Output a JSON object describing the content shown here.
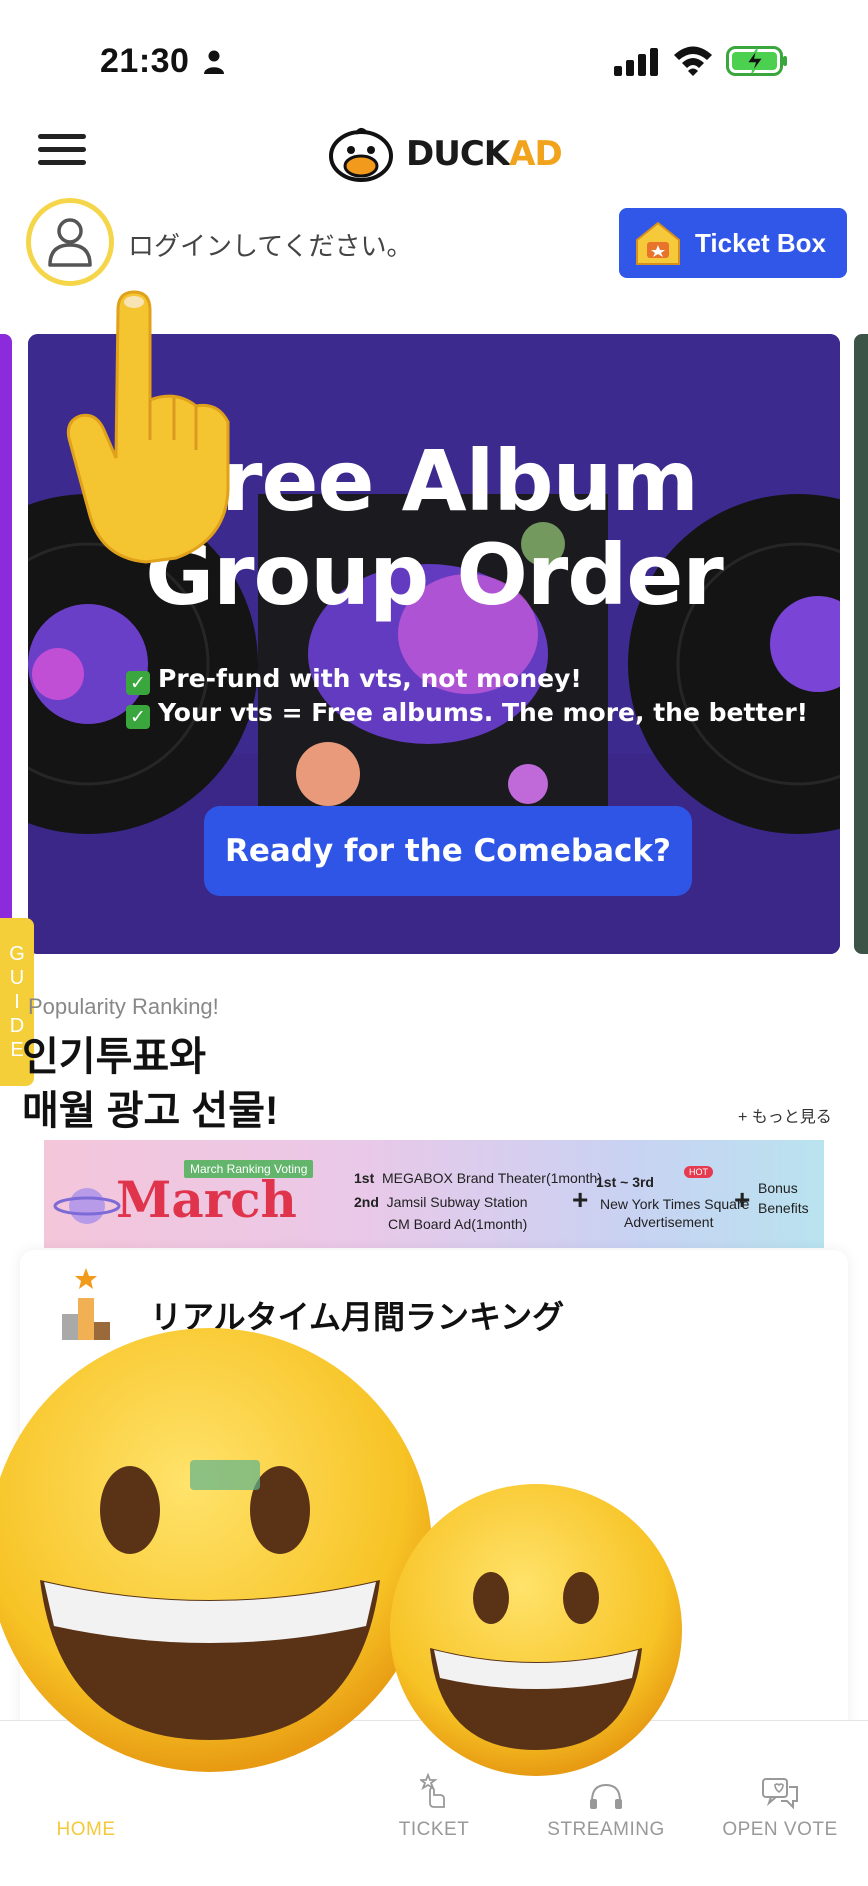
{
  "status_bar": {
    "time": "21:30"
  },
  "header": {
    "logo_duck": "DUCK",
    "logo_ad": "AD",
    "login_prompt": "ログインしてください。",
    "ticket_box_label": "Ticket Box"
  },
  "banner": {
    "title_line1": "Free Album",
    "title_line2": "Group Order",
    "line1": "Pre-fund with vts, not money!",
    "line2": "Your vts = Free albums. The more, the better!",
    "check_glyph": "✓",
    "cta_label": "Ready for the Comeback?"
  },
  "guide_tab": {
    "letters": [
      "G",
      "U",
      "I",
      "D",
      "E"
    ]
  },
  "ranking": {
    "subtitle": "Popularity Ranking!",
    "title_line1": "인기투표와",
    "title_line2": "매월 광고 선물!",
    "more_link": "+ もっと見る",
    "promo": {
      "pill": "March Ranking Voting",
      "month": "March",
      "rank1": "1st",
      "rank1_text": "MEGABOX Brand Theater(1month)",
      "rank2": "2nd",
      "rank2_text": "Jamsil Subway Station",
      "rank2_text2": "CM Board Ad(1month)",
      "plus": "+",
      "hot": "HOT",
      "top3": "1st ~ 3rd",
      "top3_text": "New York Times Square",
      "top3_text2": "Advertisement",
      "bonus1": "Bonus",
      "bonus2": "Benefits"
    },
    "card_title": "リアルタイム月間ランキング"
  },
  "tabbar": {
    "home": "HOME",
    "ticket": "TICKET",
    "streaming": "STREAMING",
    "open_vote": "OPEN VOTE"
  },
  "colors": {
    "accent_blue": "#3157e8",
    "accent_yellow": "#f5cf3a",
    "banner_purple": "#3d2a8e",
    "brand_orange": "#f2a31c"
  },
  "icons": [
    "person-icon",
    "signal-icon",
    "wifi-icon",
    "battery-charging-icon",
    "menu-icon",
    "duck-logo-icon",
    "avatar-icon",
    "house-ticket-icon",
    "podium-icon",
    "ticket-tab-icon",
    "streaming-tab-icon",
    "open-vote-tab-icon",
    "pointing-hand-emoji",
    "grinning-face-emoji"
  ]
}
